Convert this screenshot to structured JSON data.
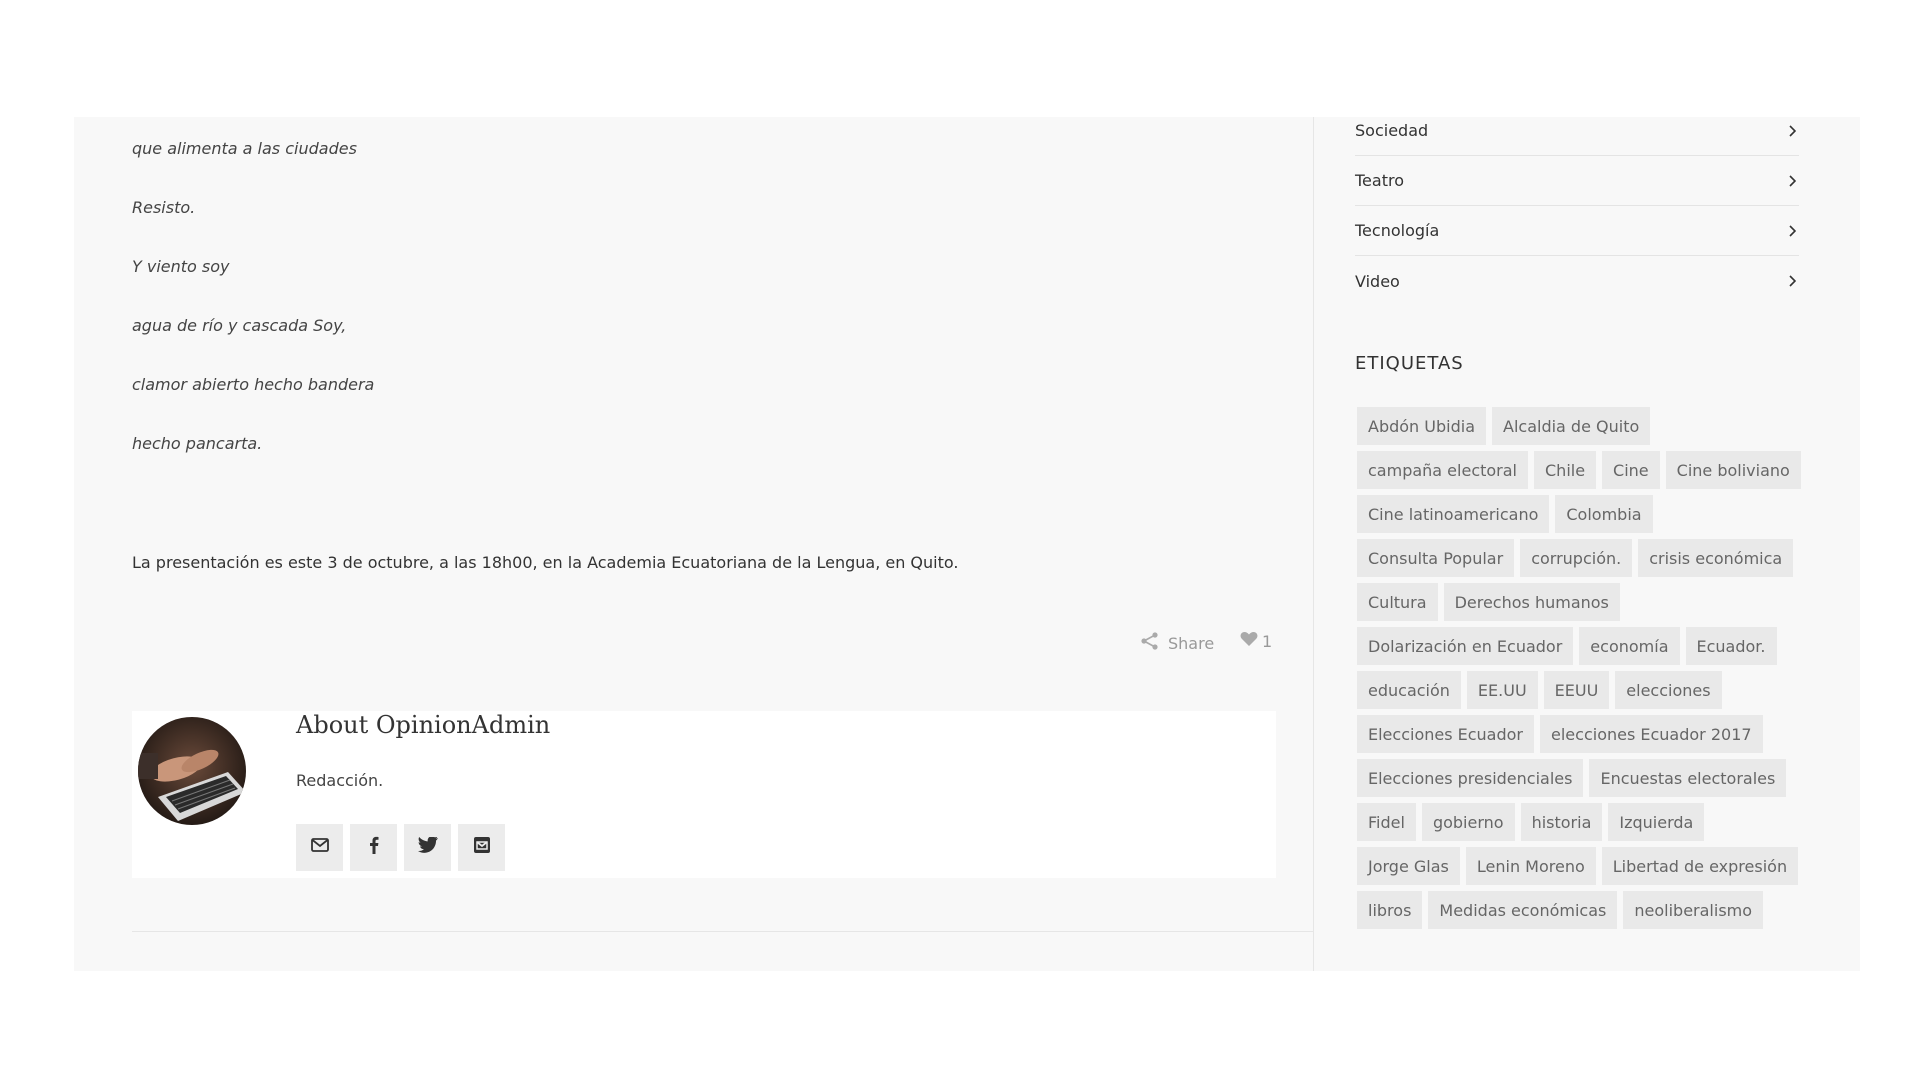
{
  "article": {
    "poem_lines": [
      "que alimenta a las ciudades",
      "Resisto.",
      "Y viento soy",
      "agua de río y cascada Soy,",
      "clamor abierto hecho bandera",
      "hecho pancarta."
    ],
    "paragraph": "La presentación es este 3 de octubre, a las 18h00, en la Academia Ecuatoriana de la Lengua, en Quito.",
    "share_label": "Share",
    "like_count": "1"
  },
  "author": {
    "title": "About OpinionAdmin",
    "description": "Redacción.",
    "social_icons": [
      "email-icon",
      "facebook-icon",
      "twitter-icon",
      "inbox-icon"
    ]
  },
  "sidebar": {
    "categories": [
      {
        "label": "Sociedad"
      },
      {
        "label": "Teatro"
      },
      {
        "label": "Tecnología"
      },
      {
        "label": "Video"
      }
    ],
    "tags_title": "ETIQUETAS",
    "tags": [
      "Abdón Ubidia",
      "Alcaldia de Quito",
      "campaña electoral",
      "Chile",
      "Cine",
      "Cine boliviano",
      "Cine latinoamericano",
      "Colombia",
      "Consulta Popular",
      "corrupción.",
      "crisis económica",
      "Cultura",
      "Derechos humanos",
      "Dolarización en Ecuador",
      "economía",
      "Ecuador.",
      "educación",
      "EE.UU",
      "EEUU",
      "elecciones",
      "Elecciones Ecuador",
      "elecciones Ecuador 2017",
      "Elecciones presidenciales",
      "Encuestas electorales",
      "Fidel",
      "gobierno",
      "historia",
      "Izquierda",
      "Jorge Glas",
      "Lenin Moreno",
      "Libertad de expresión",
      "libros",
      "Medidas económicas",
      "neoliberalismo"
    ]
  },
  "colors": {
    "page_bg": "#f8f8f8",
    "tag_bg": "#e9e9e9",
    "muted_text": "#999999"
  }
}
